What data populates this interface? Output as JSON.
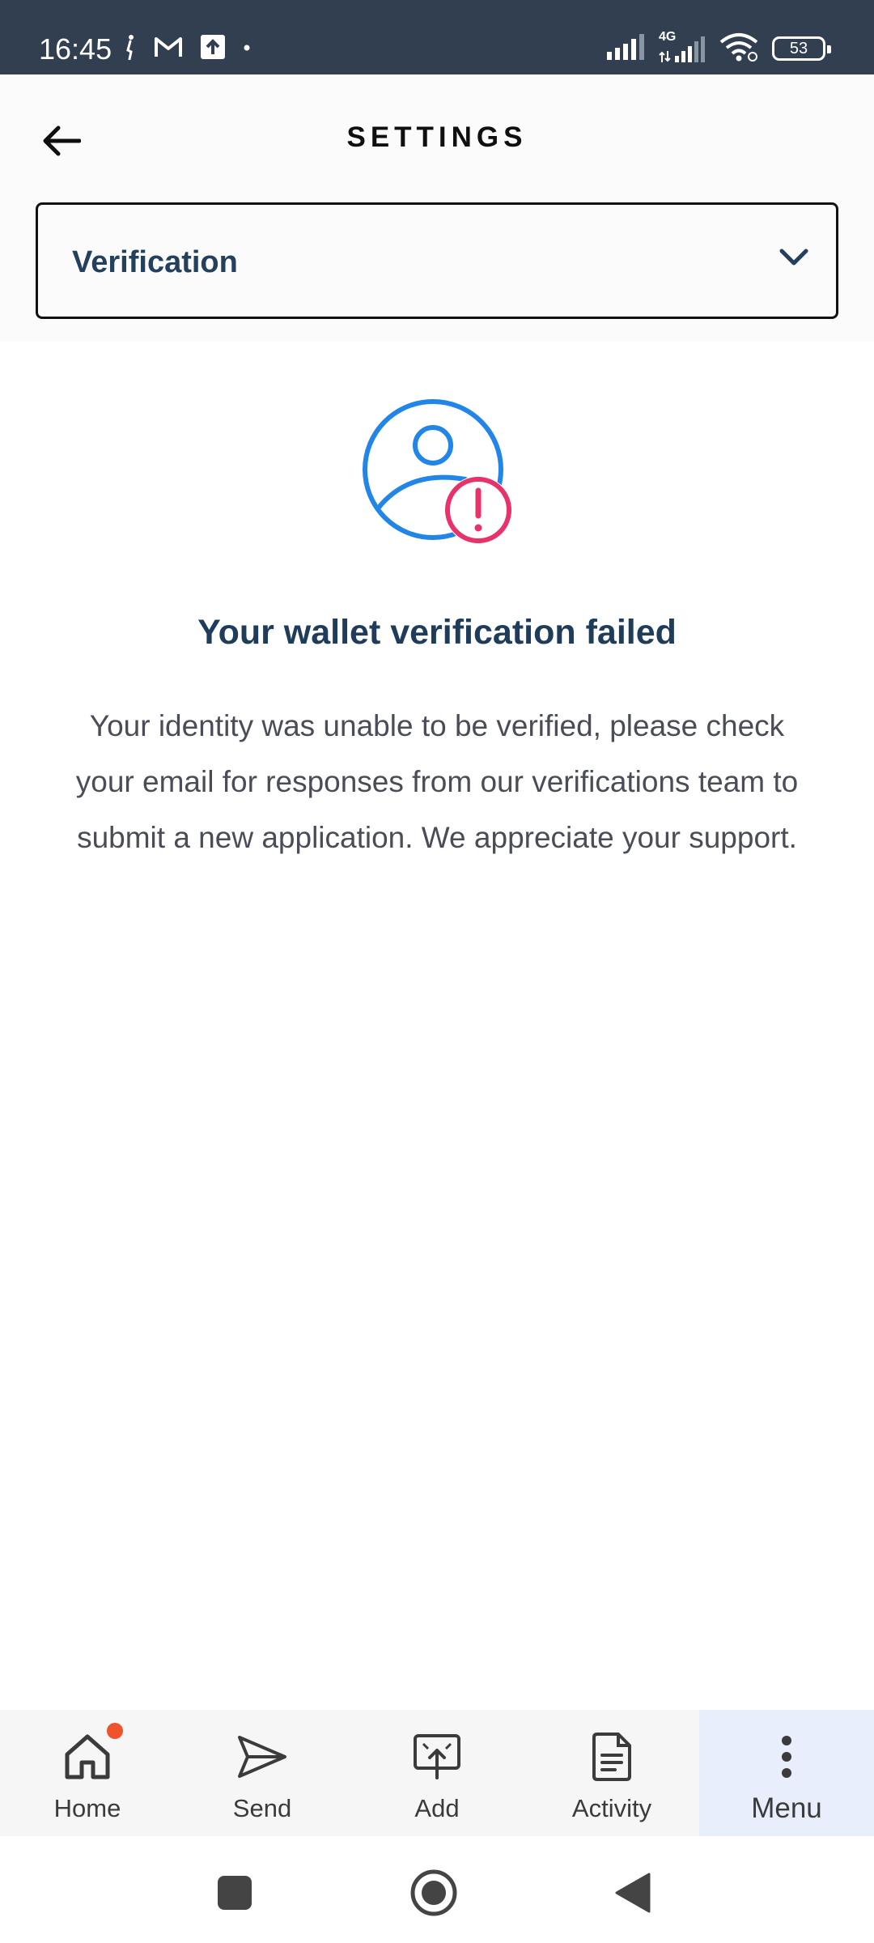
{
  "status_bar": {
    "time": "16:45",
    "left_icons": [
      "person-walking-icon",
      "gmail-icon",
      "upload-icon",
      "dot-icon"
    ],
    "right_icons": [
      "signal-icon",
      "signal-4g-icon",
      "wifi-icon",
      "battery-icon"
    ],
    "network_label": "4G",
    "battery": "53"
  },
  "header": {
    "title": "SETTINGS",
    "back_icon": "arrow-left-icon"
  },
  "section_select": {
    "selected": "Verification",
    "icon": "chevron-down-icon"
  },
  "verification": {
    "icon": "user-alert-icon",
    "title": "Your wallet verification failed",
    "message": "Your identity was unable to be verified, please check your email for responses from our verifications team to submit a new application. We appreciate your support."
  },
  "bottom_nav": {
    "items": [
      {
        "label": "Home",
        "icon": "home-icon"
      },
      {
        "label": "Send",
        "icon": "send-icon"
      },
      {
        "label": "Add",
        "icon": "add-funds-icon"
      },
      {
        "label": "Activity",
        "icon": "document-icon"
      },
      {
        "label": "Menu",
        "icon": "more-vertical-icon"
      }
    ],
    "active": "Menu"
  },
  "colors": {
    "status_bar": "#323f51",
    "accent_blue": "#2285e8",
    "alert_pink": "#e8336a",
    "text_dark": "#1f3d5a",
    "notification_dot": "#f0522b",
    "active_tab": "#e8eefc"
  }
}
